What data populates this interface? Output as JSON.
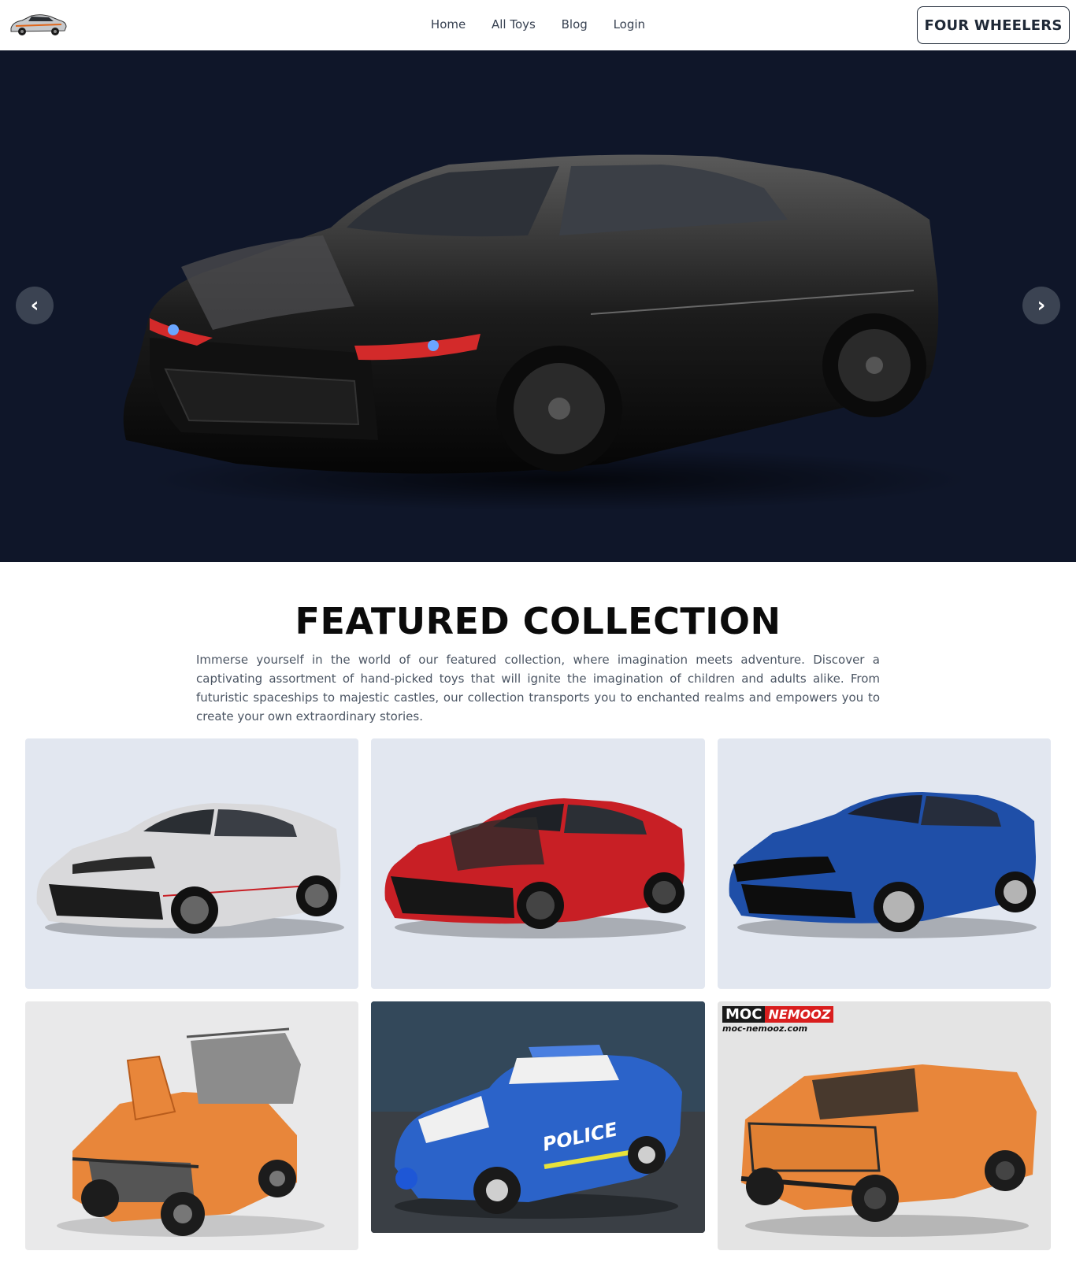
{
  "navbar": {
    "links": [
      "Home",
      "All Toys",
      "Blog",
      "Login"
    ],
    "brand_button": "FOUR WHEELERS"
  },
  "hero": {
    "prev_label": "‹",
    "next_label": "›",
    "background": "#0f1629"
  },
  "featured": {
    "title": "FEATURED COLLECTION",
    "description": "Immerse yourself in the world of our featured collection, where imagination meets adventure. Discover a captivating assortment of hand-picked toys that will ignite the imagination of children and adults alike. From futuristic spaceships to majestic castles, our collection transports you to enchanted realms and empowers you to create your own extraordinary stories."
  },
  "watermark": {
    "brand_a": "MOC",
    "brand_b": "NEMOOZ",
    "url": "moc-nemooz.com"
  },
  "police_text": "POLICE",
  "colors": {
    "hero_bg": "#0f1629",
    "card_bg": "#e2e7f0",
    "car_white": "#d9d9db",
    "car_red": "#c81f25",
    "car_blue": "#1f4fa8",
    "lego_orange": "#e8863a",
    "police_blue": "#2b63c9"
  }
}
